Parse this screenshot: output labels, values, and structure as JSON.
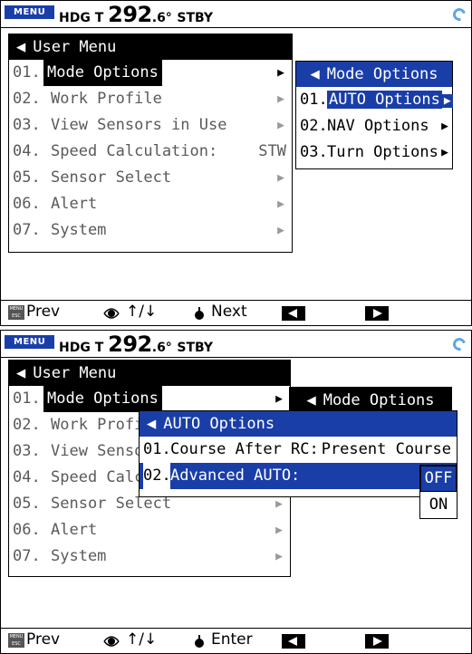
{
  "status": {
    "menu_label": "MENU",
    "hdg_prefix": "HDG T ",
    "hdg_whole": "292",
    "hdg_decimal": ".6°",
    "mode": "STBY"
  },
  "user_menu": {
    "title": "User Menu",
    "items": [
      {
        "num": "01.",
        "label": "Mode Options",
        "value": ""
      },
      {
        "num": "02.",
        "label": "Work Profile",
        "value": ""
      },
      {
        "num": "03.",
        "label": "View Sensors in Use",
        "value": ""
      },
      {
        "num": "04.",
        "label": "Speed Calculation:",
        "value": "STW"
      },
      {
        "num": "05.",
        "label": "Sensor Select",
        "value": ""
      },
      {
        "num": "06.",
        "label": "Alert",
        "value": ""
      },
      {
        "num": "07.",
        "label": "System",
        "value": ""
      }
    ],
    "bottom_items": [
      {
        "num": "01.",
        "label": "Mode Options"
      },
      {
        "num": "02.",
        "label": "Work Profil"
      },
      {
        "num": "03.",
        "label": "View Sensor"
      },
      {
        "num": "04.",
        "label": "Speed Calcu"
      },
      {
        "num": "05.",
        "label": "Sensor Select"
      },
      {
        "num": "06.",
        "label": "Alert"
      },
      {
        "num": "07.",
        "label": "System"
      }
    ]
  },
  "mode_options": {
    "title": "Mode Options",
    "items": [
      {
        "num": "01.",
        "label": "AUTO Options"
      },
      {
        "num": "02.",
        "label": "NAV Options"
      },
      {
        "num": "03.",
        "label": "Turn Options"
      }
    ]
  },
  "auto_options": {
    "title": "AUTO Options",
    "items": [
      {
        "num": "01.",
        "label": "Course After RC:",
        "value": "Present Course"
      },
      {
        "num": "02.",
        "label": "Advanced AUTO:",
        "value": ""
      }
    ],
    "choices": [
      "OFF",
      "ON"
    ]
  },
  "footer_top": {
    "esc": "MENU\nESC",
    "prev": "Prev",
    "updown": "↑/↓",
    "action": "Next"
  },
  "footer_bottom": {
    "esc": "MENU\nESC",
    "prev": "Prev",
    "updown": "↑/↓",
    "action": "Enter"
  }
}
